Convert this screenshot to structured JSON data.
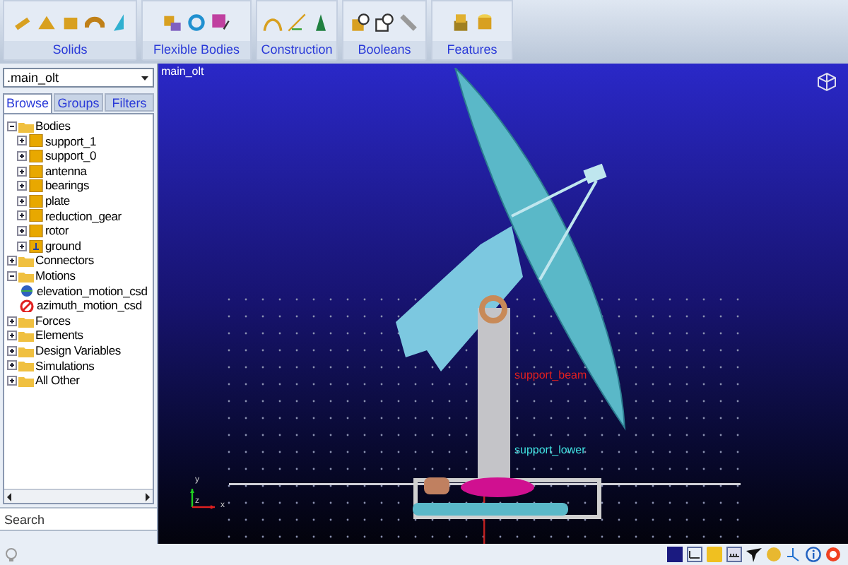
{
  "ribbon": {
    "groups": [
      {
        "label": "Solids"
      },
      {
        "label": "Flexible Bodies"
      },
      {
        "label": "Construction"
      },
      {
        "label": "Booleans"
      },
      {
        "label": "Features"
      }
    ]
  },
  "browser": {
    "model_select": ".main_olt",
    "tabs": [
      {
        "label": "Browse",
        "selected": true
      },
      {
        "label": "Groups",
        "selected": false
      },
      {
        "label": "Filters",
        "selected": false
      }
    ],
    "tree": [
      {
        "label": "Bodies",
        "kind": "folder",
        "expanded": true,
        "children": [
          {
            "label": "support_1",
            "kind": "part",
            "expanded": false
          },
          {
            "label": "support_0",
            "kind": "part",
            "expanded": false
          },
          {
            "label": "antenna",
            "kind": "part",
            "expanded": false
          },
          {
            "label": "bearings",
            "kind": "part",
            "expanded": false
          },
          {
            "label": "plate",
            "kind": "part",
            "expanded": false
          },
          {
            "label": "reduction_gear",
            "kind": "part",
            "expanded": false
          },
          {
            "label": "rotor",
            "kind": "part",
            "expanded": false
          },
          {
            "label": "ground",
            "kind": "ground",
            "expanded": false
          }
        ]
      },
      {
        "label": "Connectors",
        "kind": "folder",
        "expanded": false
      },
      {
        "label": "Motions",
        "kind": "folder",
        "expanded": true,
        "children": [
          {
            "label": "elevation_motion_csd",
            "kind": "motion-globe"
          },
          {
            "label": "azimuth_motion_csd",
            "kind": "motion-stop"
          }
        ]
      },
      {
        "label": "Forces",
        "kind": "folder",
        "expanded": false
      },
      {
        "label": "Elements",
        "kind": "folder",
        "expanded": false
      },
      {
        "label": "Design Variables",
        "kind": "folder",
        "expanded": false
      },
      {
        "label": "Simulations",
        "kind": "folder",
        "expanded": false
      },
      {
        "label": "All Other",
        "kind": "folder",
        "expanded": false
      }
    ],
    "search": {
      "placeholder": "Search"
    }
  },
  "viewport": {
    "model_name": "main_olt",
    "labels": [
      {
        "text": "support_beam",
        "color": "#e02020"
      },
      {
        "text": "support_lower",
        "color": "#40e0e0"
      }
    ],
    "axes": {
      "x": "x",
      "y": "y",
      "z": "z"
    }
  }
}
